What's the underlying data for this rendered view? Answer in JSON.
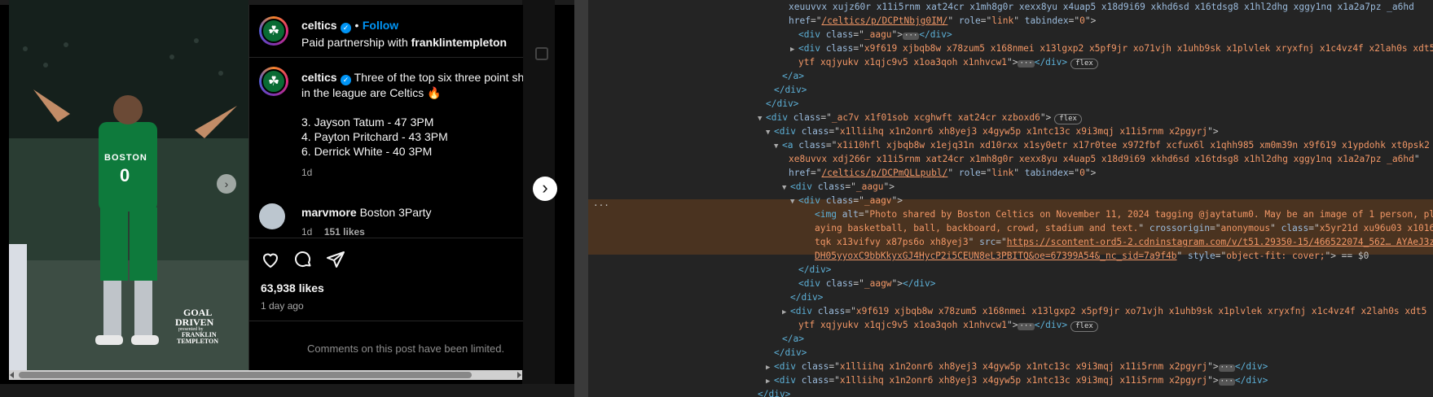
{
  "post": {
    "username": "celtics",
    "follow_label": "Follow",
    "separator": "•",
    "partnership_prefix": "Paid partnership with ",
    "partner": "franklintempleton",
    "caption_user": "celtics",
    "caption_line1": " Three of the top six three point sh",
    "caption_line2": "in the league are Celtics 🔥",
    "list": [
      "3. Jayson Tatum - 47 3PM",
      "4. Payton Pritchard - 43 3PM",
      "6. Derrick White - 40 3PM"
    ],
    "caption_age": "1d",
    "comment_user": "marvmore",
    "comment_text": " Boston 3Party",
    "comment_age": "1d",
    "comment_likes": "151 likes",
    "likes": "63,938 likes",
    "posted": "1 day ago",
    "comments_limited": "Comments on this post have been limited.",
    "jersey_team": "BOSTON",
    "jersey_number": "0",
    "sponsor_line1": "GOAL",
    "sponsor_line2": "DRIVEN",
    "sponsor_line3": "presented by",
    "sponsor_line4": "FRANKLIN",
    "sponsor_line5": "TEMPLETON"
  },
  "devtools": {
    "lines": [
      {
        "indent": 246,
        "parts": [
          [
            "attr",
            "xeuuvvx xujz60r x11i5rnm xat24cr x1mh8g0r xexx8yu x4uap5 x18d9i69 xkhd6sd x16tdsg8 x1hl2dhg xggy1nq x1a2a7pz _a6hd"
          ]
        ]
      },
      {
        "indent": 246,
        "parts": [
          [
            "attr",
            "href"
          ],
          [
            "plain",
            "=\""
          ],
          [
            "link",
            "/celtics/p/DCPtNbjg0IM/"
          ],
          [
            "plain",
            "\" "
          ],
          [
            "attr",
            "role"
          ],
          [
            "plain",
            "=\""
          ],
          [
            "val",
            "link"
          ],
          [
            "plain",
            "\" "
          ],
          [
            "attr",
            "tabindex"
          ],
          [
            "plain",
            "=\""
          ],
          [
            "val",
            "0"
          ],
          [
            "plain",
            "\">"
          ]
        ]
      },
      {
        "indent": 248,
        "tri": "",
        "parts": [
          [
            "tag",
            "<div "
          ],
          [
            "attr",
            "class"
          ],
          [
            "plain",
            "=\""
          ],
          [
            "val",
            "_aagu"
          ],
          [
            "plain",
            "\">"
          ],
          [
            "ell",
            "···"
          ],
          [
            "tag",
            "</div>"
          ]
        ]
      },
      {
        "indent": 248,
        "tri": "▶",
        "parts": [
          [
            "tag",
            "<div "
          ],
          [
            "attr",
            "class"
          ],
          [
            "plain",
            "=\""
          ],
          [
            "val",
            "x9f619 xjbqb8w x78zum5 x168nmei x13lgxp2 x5pf9jr xo71vjh x1uhb9sk x1plvlek xryxfnj x1c4vz4f x2lah0s xdt5"
          ],
          [
            "plain",
            ""
          ]
        ]
      },
      {
        "indent": 258,
        "parts": [
          [
            "val",
            "ytf xqjyukv x1qjc9v5 x1oa3qoh x1nhvcw1"
          ],
          [
            "plain",
            "\">"
          ],
          [
            "ell",
            "···"
          ],
          [
            "tag",
            "</div>"
          ],
          [
            "badge",
            "flex"
          ]
        ]
      },
      {
        "indent": 238,
        "parts": [
          [
            "tag",
            "</a>"
          ]
        ]
      },
      {
        "indent": 228,
        "parts": [
          [
            "tag",
            "</div>"
          ]
        ]
      },
      {
        "indent": 218,
        "parts": [
          [
            "tag",
            "</div>"
          ]
        ]
      },
      {
        "indent": 208,
        "tri": "▼",
        "parts": [
          [
            "tag",
            "<div "
          ],
          [
            "attr",
            "class"
          ],
          [
            "plain",
            "=\""
          ],
          [
            "val",
            "_ac7v x1f01sob xcghwft xat24cr xzboxd6"
          ],
          [
            "plain",
            "\">"
          ],
          [
            "badge",
            "flex"
          ]
        ]
      },
      {
        "indent": 218,
        "tri": "▼",
        "parts": [
          [
            "tag",
            "<div "
          ],
          [
            "attr",
            "class"
          ],
          [
            "plain",
            "=\""
          ],
          [
            "val",
            "x1lliihq x1n2onr6 xh8yej3 x4gyw5p x1ntc13c x9i3mqj x11i5rnm x2pgyrj"
          ],
          [
            "plain",
            "\">"
          ]
        ]
      },
      {
        "indent": 228,
        "tri": "▼",
        "parts": [
          [
            "tag",
            "<a "
          ],
          [
            "attr",
            "class"
          ],
          [
            "plain",
            "=\""
          ],
          [
            "val",
            "x1i10hfl xjbqb8w x1ejq31n xd10rxx x1sy0etr x17r0tee x972fbf xcfux6l x1qhh985 xm0m39n x9f619 x1ypdohk xt0psk2"
          ]
        ]
      },
      {
        "indent": 246,
        "parts": [
          [
            "val",
            "xe8uvvx xdj266r x11i5rnm xat24cr x1mh8g0r xexx8yu x4uap5 x18d9i69 xkhd6sd x16tdsg8 x1hl2dhg xggy1nq x1a2a7pz _a6hd"
          ],
          [
            "plain",
            "\""
          ]
        ]
      },
      {
        "indent": 246,
        "parts": [
          [
            "attr",
            "href"
          ],
          [
            "plain",
            "=\""
          ],
          [
            "link",
            "/celtics/p/DCPmQLLpubl/"
          ],
          [
            "plain",
            "\" "
          ],
          [
            "attr",
            "role"
          ],
          [
            "plain",
            "=\""
          ],
          [
            "val",
            "link"
          ],
          [
            "plain",
            "\" "
          ],
          [
            "attr",
            "tabindex"
          ],
          [
            "plain",
            "=\""
          ],
          [
            "val",
            "0"
          ],
          [
            "plain",
            "\">"
          ]
        ]
      },
      {
        "indent": 238,
        "tri": "▼",
        "parts": [
          [
            "tag",
            "<div "
          ],
          [
            "attr",
            "class"
          ],
          [
            "plain",
            "=\""
          ],
          [
            "val",
            "_aagu"
          ],
          [
            "plain",
            "\">"
          ]
        ]
      },
      {
        "indent": 248,
        "tri": "▼",
        "parts": [
          [
            "tag",
            "<div "
          ],
          [
            "attr",
            "class"
          ],
          [
            "plain",
            "=\""
          ],
          [
            "val",
            "_aagv"
          ],
          [
            "plain",
            "\">"
          ]
        ]
      },
      {
        "indent": 278,
        "parts": [
          [
            "tag",
            "<img "
          ],
          [
            "attr",
            "alt"
          ],
          [
            "plain",
            "=\""
          ],
          [
            "val",
            "Photo shared by Boston Celtics on November 11, 2024 tagging @jaytatum0. May be an image of 1 person, pl"
          ]
        ]
      },
      {
        "indent": 278,
        "parts": [
          [
            "val",
            "aying basketball, ball, backboard, crowd, stadium and text."
          ],
          [
            "plain",
            "\" "
          ],
          [
            "attr",
            "crossorigin"
          ],
          [
            "plain",
            "=\""
          ],
          [
            "val",
            "anonymous"
          ],
          [
            "plain",
            "\" "
          ],
          [
            "attr",
            "class"
          ],
          [
            "plain",
            "=\""
          ],
          [
            "val",
            "x5yr21d xu96u03 x1016"
          ]
        ]
      },
      {
        "indent": 278,
        "parts": [
          [
            "val",
            "tqk x13vifvy x87ps6o xh8yej3"
          ],
          [
            "plain",
            "\" "
          ],
          [
            "attr",
            "src"
          ],
          [
            "plain",
            "=\""
          ],
          [
            "link",
            "https://scontent-ord5-2.cdninstagram.com/v/t51.29350-15/466522074_562… AYAeJ3z"
          ]
        ]
      },
      {
        "indent": 278,
        "parts": [
          [
            "link",
            "DH05yyoxC9bbKkyxGJ4HycP2i5CEUN8eL3PBITQ&oe=67399A54&_nc_sid=7a9f4b"
          ],
          [
            "plain",
            "\" "
          ],
          [
            "attr",
            "style"
          ],
          [
            "plain",
            "=\""
          ],
          [
            "val",
            "object-fit: cover;"
          ],
          [
            "plain",
            "\"> == $0"
          ]
        ]
      },
      {
        "indent": 258,
        "parts": [
          [
            "tag",
            "</div>"
          ]
        ]
      },
      {
        "indent": 258,
        "parts": [
          [
            "tag",
            "<div "
          ],
          [
            "attr",
            "class"
          ],
          [
            "plain",
            "=\""
          ],
          [
            "val",
            "_aagw"
          ],
          [
            "plain",
            "\">"
          ],
          [
            "tag",
            "</div>"
          ]
        ]
      },
      {
        "indent": 248,
        "parts": [
          [
            "tag",
            "</div>"
          ]
        ]
      },
      {
        "indent": 238,
        "tri": "▶",
        "parts": [
          [
            "tag",
            "<div "
          ],
          [
            "attr",
            "class"
          ],
          [
            "plain",
            "=\""
          ],
          [
            "val",
            "x9f619 xjbqb8w x78zum5 x168nmei x13lgxp2 x5pf9jr xo71vjh x1uhb9sk x1plvlek xryxfnj x1c4vz4f x2lah0s xdt5"
          ]
        ]
      },
      {
        "indent": 258,
        "parts": [
          [
            "val",
            "ytf xqjyukv x1qjc9v5 x1oa3qoh x1nhvcw1"
          ],
          [
            "plain",
            "\">"
          ],
          [
            "ell",
            "···"
          ],
          [
            "tag",
            "</div>"
          ],
          [
            "badge",
            "flex"
          ]
        ]
      },
      {
        "indent": 238,
        "parts": [
          [
            "tag",
            "</a>"
          ]
        ]
      },
      {
        "indent": 228,
        "parts": [
          [
            "tag",
            "</div>"
          ]
        ]
      },
      {
        "indent": 218,
        "tri": "▶",
        "parts": [
          [
            "tag",
            "<div "
          ],
          [
            "attr",
            "class"
          ],
          [
            "plain",
            "=\""
          ],
          [
            "val",
            "x1lliihq x1n2onr6 xh8yej3 x4gyw5p x1ntc13c x9i3mqj x11i5rnm x2pgyrj"
          ],
          [
            "plain",
            "\">"
          ],
          [
            "ell",
            "···"
          ],
          [
            "tag",
            "</div>"
          ]
        ]
      },
      {
        "indent": 218,
        "tri": "▶",
        "parts": [
          [
            "tag",
            "<div "
          ],
          [
            "attr",
            "class"
          ],
          [
            "plain",
            "=\""
          ],
          [
            "val",
            "x1lliihq x1n2onr6 xh8yej3 x4gyw5p x1ntc13c x9i3mqj x11i5rnm x2pgyrj"
          ],
          [
            "plain",
            "\">"
          ],
          [
            "ell",
            "···"
          ],
          [
            "tag",
            "</div>"
          ]
        ]
      },
      {
        "indent": 208,
        "parts": [
          [
            "tag",
            "</div>"
          ]
        ]
      }
    ]
  }
}
